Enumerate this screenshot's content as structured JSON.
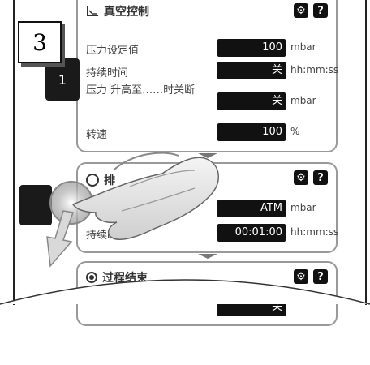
{
  "step_number": "3",
  "step_tab_number": "1",
  "panel_vacuum": {
    "title": "真空控制",
    "rows": [
      {
        "label": "压力设定值",
        "value": "100",
        "unit": "mbar"
      },
      {
        "label": "持续时间",
        "value": "关",
        "unit": "hh:mm:ss"
      },
      {
        "label": "压力 升高至……时关断",
        "value": "关",
        "unit": "mbar"
      },
      {
        "label": "转速",
        "value": "100",
        "unit": "%"
      }
    ]
  },
  "panel_second": {
    "title": "排",
    "rows": [
      {
        "label": "",
        "value": "ATM",
        "unit": "mbar"
      },
      {
        "label": "持续时",
        "value": "00:01:00",
        "unit": "hh:mm:ss"
      }
    ]
  },
  "panel_end": {
    "title": "过程结束",
    "rows": [
      {
        "label": "",
        "value": "关",
        "unit": ""
      }
    ]
  },
  "icons": {
    "settings": "⚙",
    "help": "?"
  },
  "colors": {
    "dark": "#111111",
    "border": "#999999"
  }
}
